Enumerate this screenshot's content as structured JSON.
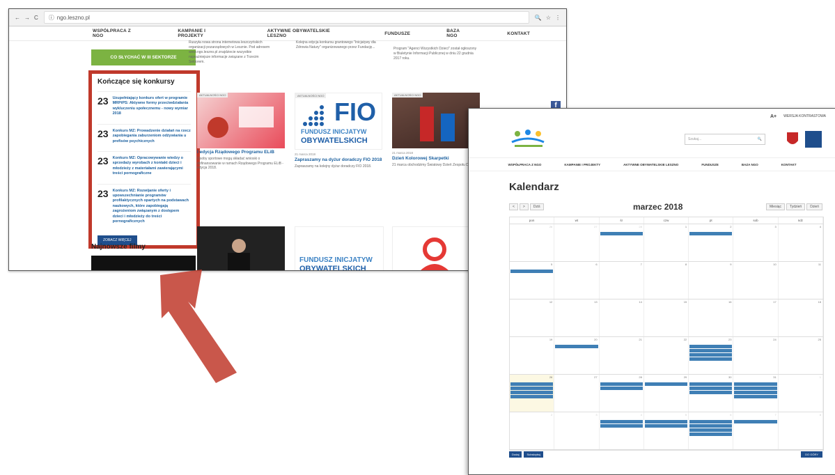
{
  "browser": {
    "url": "ngo.leszno.pl",
    "nav_back": "←",
    "nav_forward": "→",
    "nav_reload": "C",
    "info_icon": "ⓘ",
    "zoom_icon": "🔍",
    "star_icon": "☆",
    "menu_icon": "⋮"
  },
  "site_menu": [
    "WSPÓŁPRACA Z NGO",
    "KAMPANIE I PROJEKTY",
    "AKTYWNE OBYWATELSKIE LESZNO",
    "FUNDUSZE",
    "BAZA NGO",
    "KONTAKT"
  ],
  "sidebar": {
    "green_button": "CO SŁYCHAĆ W III SEKTORZE",
    "contests_title": "Kończące się konkursy",
    "contests": [
      {
        "day": "23",
        "text": "Uzupełniający konkurs ofert w programie MRPiPS: Aktywne formy przeciwdziałania wykluczeniu społecznemu - nowy wymiar 2018"
      },
      {
        "day": "23",
        "text": "Konkurs MZ: Prowadzenie działań na rzecz zapobiegania zaburzeniom odżywiania u prefisów psychicznych"
      },
      {
        "day": "23",
        "text": "Konkurs MZ: Opracowywanie wiedzy o sprzedaży wyrobach z kontakt dzieci i młodzieży z materiałami zawierającymi treści pornograficzne"
      },
      {
        "day": "23",
        "text": "Konkurs MZ: Rozwijanie oferty i upowszechnianie programów profilaktycznych opartych na podstawach naukowych, które zapobiegają zagrożeniom związanym z dostępem dzieci i młodzieży do treści pornograficznych"
      }
    ],
    "more_button": "ZOBACZ WIĘCEJ",
    "films_title": "Najnowsze filmy"
  },
  "cards": [
    {
      "tag": "AKTUALNOŚCI NGO",
      "date": "",
      "title": "I edycja Rządowego Programu ELiB",
      "desc": "Osoby sportowe mogą składać wnioski o dofinansowanie w ramach Rządowego Programu ELiB - edycja 2018."
    },
    {
      "tag": "AKTUALNOŚCI NGO",
      "date": "21 marca 2018",
      "title": "Zapraszamy na dyżur doradczy FIO 2018",
      "desc": "Zapraszamy na kolejny dyżur doradczy FIO 2018."
    },
    {
      "tag": "AKTUALNOŚCI NGO",
      "date": "21 marca 2018",
      "title": "Dzień Kolorowej Skarpetki",
      "desc": "21 marca obchodzimy Światowy Dzień Zespołu Downa."
    }
  ],
  "fio": {
    "big": "FIO",
    "line1": "FUNDUSZ INICJATYW",
    "line2": "OBYWATELSKICH"
  },
  "second_window": {
    "top_links": [
      "A+",
      "WERSJA KONTRASTOWA"
    ],
    "search_placeholder": "Szukaj...",
    "search_icon": "🔍",
    "menu": [
      "WSPÓŁPRACA Z NGO",
      "KAMPANIE I PROJEKTY",
      "AKTYWNE OBYWATELSKIE LESZNO",
      "FUNDUSZE",
      "BAZA NGO",
      "KONTAKT"
    ],
    "page_title": "Kalendarz",
    "month": "marzec 2018",
    "today_button": "Dziś",
    "view_buttons": [
      "Miesiąc",
      "Tydzień",
      "Dzień"
    ],
    "dow": [
      "pon",
      "wt",
      "śr",
      "czw",
      "pt",
      "sob",
      "ndz"
    ],
    "weeks": [
      [
        "26",
        "27",
        "28",
        "1",
        "2",
        "3",
        "4"
      ],
      [
        "5",
        "6",
        "7",
        "8",
        "9",
        "10",
        "11"
      ],
      [
        "12",
        "13",
        "14",
        "15",
        "16",
        "17",
        "18"
      ],
      [
        "19",
        "20",
        "21",
        "22",
        "23",
        "24",
        "25"
      ],
      [
        "26",
        "27",
        "28",
        "29",
        "30",
        "31",
        "1"
      ],
      [
        "2",
        "3",
        "4",
        "5",
        "6",
        "7",
        "8"
      ]
    ],
    "footer_left": [
      "Dodaj",
      "Subskrybuj"
    ],
    "footer_right": "DO GÓRY"
  },
  "colors": {
    "accent_blue": "#1f4e8c",
    "green": "#7cb342",
    "highlight_red": "#c0392b"
  }
}
